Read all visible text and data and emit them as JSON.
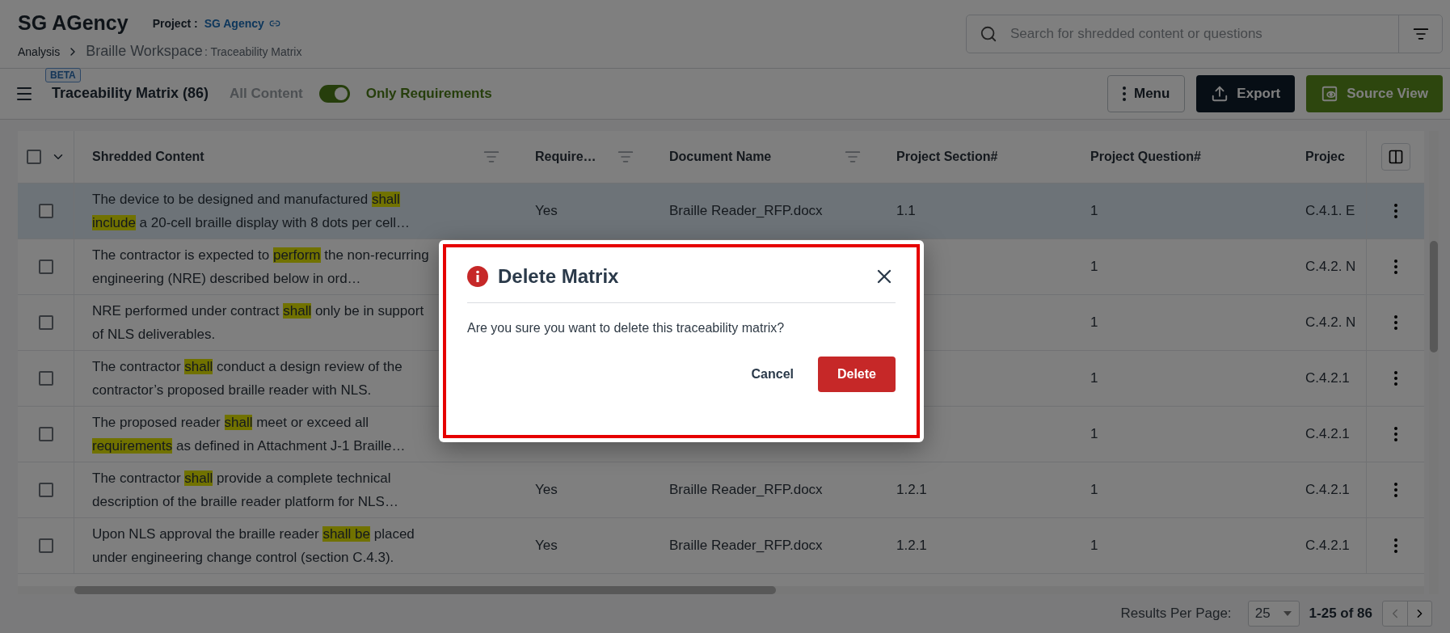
{
  "header": {
    "title": "SG AGency",
    "project_label": "Project :",
    "project_name": "SG Agency",
    "breadcrumb": {
      "root": "Analysis",
      "workspace": "Braille Workspace",
      "page": ": Traceability Matrix"
    }
  },
  "search": {
    "placeholder": "Search for shredded content or questions"
  },
  "toolbar": {
    "badge": "BETA",
    "title": "Traceability Matrix (86)",
    "toggle": {
      "off_label": "All Content",
      "on_label": "Only Requirements",
      "on": true
    },
    "buttons": [
      {
        "kind": "menu",
        "label": "Menu"
      },
      {
        "kind": "export",
        "label": "Export"
      },
      {
        "kind": "source",
        "label": "Source View"
      }
    ]
  },
  "table": {
    "all_checked": false,
    "columns": [
      {
        "label": "Shredded Content",
        "filter": true
      },
      {
        "label": "Require…",
        "filter": true
      },
      {
        "label": "Document Name",
        "filter": true
      },
      {
        "label": "Project Section#",
        "filter": false
      },
      {
        "label": "Project Question#",
        "filter": false
      },
      {
        "label": "Projec",
        "filter": false
      }
    ],
    "rows": [
      {
        "selected": true,
        "checked": false,
        "cells": [
          {
            "segments": [
              {
                "text": "The device to be designed and manufactured ",
                "highlighted": false
              },
              {
                "text": "shall include",
                "highlighted": true
              },
              {
                "text": " a 20-cell braille display with 8 dots per cell…",
                "highlighted": false
              }
            ]
          },
          "Yes",
          "Braille Reader_RFP.docx",
          "1.1",
          "1",
          "C.4.1. E"
        ]
      },
      {
        "selected": false,
        "checked": false,
        "cells": [
          {
            "segments": [
              {
                "text": "The contractor is expected to ",
                "highlighted": false
              },
              {
                "text": "perform",
                "highlighted": true
              },
              {
                "text": " the non-recurring engineering (NRE) described below in ord…",
                "highlighted": false
              }
            ]
          },
          "",
          "",
          "",
          "1",
          "C.4.2. N"
        ]
      },
      {
        "selected": false,
        "checked": false,
        "cells": [
          {
            "segments": [
              {
                "text": "NRE performed under contract ",
                "highlighted": false
              },
              {
                "text": "shall",
                "highlighted": true
              },
              {
                "text": " only be in support of NLS deliverables.",
                "highlighted": false
              }
            ]
          },
          "",
          "",
          "",
          "1",
          "C.4.2. N"
        ]
      },
      {
        "selected": false,
        "checked": false,
        "cells": [
          {
            "segments": [
              {
                "text": "The contractor ",
                "highlighted": false
              },
              {
                "text": "shall",
                "highlighted": true
              },
              {
                "text": " conduct a design review of the contractor’s proposed braille reader with NLS.",
                "highlighted": false
              }
            ]
          },
          "",
          "",
          "",
          "1",
          "C.4.2.1"
        ]
      },
      {
        "selected": false,
        "checked": false,
        "cells": [
          {
            "segments": [
              {
                "text": "The proposed reader ",
                "highlighted": false
              },
              {
                "text": "shall",
                "highlighted": true
              },
              {
                "text": " meet or exceed all ",
                "highlighted": false
              },
              {
                "text": "requirements",
                "highlighted": true
              },
              {
                "text": " as defined in Attachment J-1 Braille…",
                "highlighted": false
              }
            ]
          },
          "",
          "",
          "",
          "1",
          "C.4.2.1"
        ]
      },
      {
        "selected": false,
        "checked": false,
        "cells": [
          {
            "segments": [
              {
                "text": "The contractor ",
                "highlighted": false
              },
              {
                "text": "shall",
                "highlighted": true
              },
              {
                "text": " provide a complete technical description of the braille reader platform for NLS…",
                "highlighted": false
              }
            ]
          },
          "Yes",
          "Braille Reader_RFP.docx",
          "1.2.1",
          "1",
          "C.4.2.1"
        ]
      },
      {
        "selected": false,
        "checked": false,
        "cells": [
          {
            "segments": [
              {
                "text": "Upon NLS approval the braille reader ",
                "highlighted": false
              },
              {
                "text": "shall be",
                "highlighted": true
              },
              {
                "text": " placed under engineering change control (section C.4.3).",
                "highlighted": false
              }
            ]
          },
          "Yes",
          "Braille Reader_RFP.docx",
          "1.2.1",
          "1",
          "C.4.2.1"
        ]
      }
    ]
  },
  "pagination": {
    "label": "Results Per Page:",
    "per_page": "25",
    "range": "1-25 of 86"
  },
  "dialog": {
    "title": "Delete Matrix",
    "message": "Are you sure you want to delete this traceability matrix?",
    "buttons": [
      {
        "kind": "secondary",
        "label": "Cancel"
      },
      {
        "kind": "danger",
        "label": "Delete"
      }
    ]
  }
}
